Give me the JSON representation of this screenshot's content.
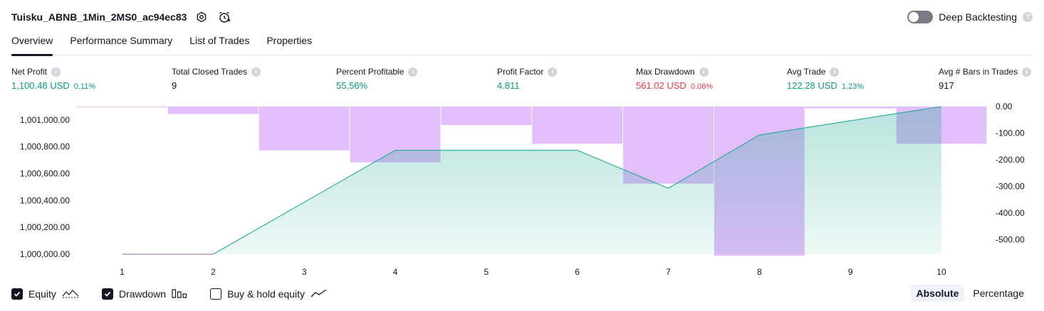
{
  "header": {
    "strategy_name": "Tuisku_ABNB_1Min_2MS0_ac94ec83",
    "icons": [
      "settings-icon",
      "alert-clock-icon"
    ],
    "deep_backtesting_label": "Deep Backtesting",
    "deep_backtesting_on": false
  },
  "tabs": [
    {
      "label": "Overview",
      "active": true
    },
    {
      "label": "Performance Summary",
      "active": false
    },
    {
      "label": "List of Trades",
      "active": false
    },
    {
      "label": "Properties",
      "active": false
    }
  ],
  "metrics": {
    "net_profit": {
      "label": "Net Profit",
      "value": "1,100.48 USD",
      "pct": "0.11%"
    },
    "total_closed_trades": {
      "label": "Total Closed Trades",
      "value": "9"
    },
    "percent_profitable": {
      "label": "Percent Profitable",
      "value": "55.56%"
    },
    "profit_factor": {
      "label": "Profit Factor",
      "value": "4.811"
    },
    "max_drawdown": {
      "label": "Max Drawdown",
      "value": "561.02 USD",
      "pct": "0.06%"
    },
    "avg_trade": {
      "label": "Avg Trade",
      "value": "122.28 USD",
      "pct": "1.23%"
    },
    "avg_bars": {
      "label": "Avg # Bars in Trades",
      "value": "917"
    }
  },
  "chart_data": {
    "type": "area",
    "x": [
      1,
      2,
      3,
      4,
      5,
      6,
      7,
      8,
      9,
      10
    ],
    "series": [
      {
        "name": "Equity",
        "axis": "left",
        "values": [
          1000000,
          1000000,
          null,
          1000774,
          null,
          1000774,
          1000491,
          1000888,
          null,
          1001100
        ]
      },
      {
        "name": "Drawdown",
        "axis": "right",
        "values": [
          -2,
          -28,
          -165,
          -210,
          -70,
          -140,
          -290,
          -561,
          -7,
          -140
        ]
      }
    ],
    "left_axis": {
      "ticks": [
        "1,001,000.00",
        "1,000,800.00",
        "1,000,600.00",
        "1,000,400.00",
        "1,000,200.00",
        "1,000,000.00"
      ],
      "range": [
        1000000,
        1001100
      ]
    },
    "right_axis": {
      "ticks": [
        "0.00",
        "-100.00",
        "-200.00",
        "-300.00",
        "-400.00",
        "-500.00"
      ],
      "range": [
        -555,
        0
      ]
    },
    "colors": {
      "equity_line": "#22ab94",
      "equity_fill": "#22ab94",
      "drawdown_bar": "#ce93f8",
      "pre_trade_line": "#b2a0b5"
    }
  },
  "legend": [
    {
      "label": "Equity",
      "checked": true,
      "icon": "equity-line-icon"
    },
    {
      "label": "Drawdown",
      "checked": true,
      "icon": "drawdown-bars-icon"
    },
    {
      "label": "Buy & hold equity",
      "checked": false,
      "icon": "buy-hold-line-icon"
    }
  ],
  "mode": {
    "absolute_label": "Absolute",
    "percentage_label": "Percentage",
    "active": "absolute"
  }
}
